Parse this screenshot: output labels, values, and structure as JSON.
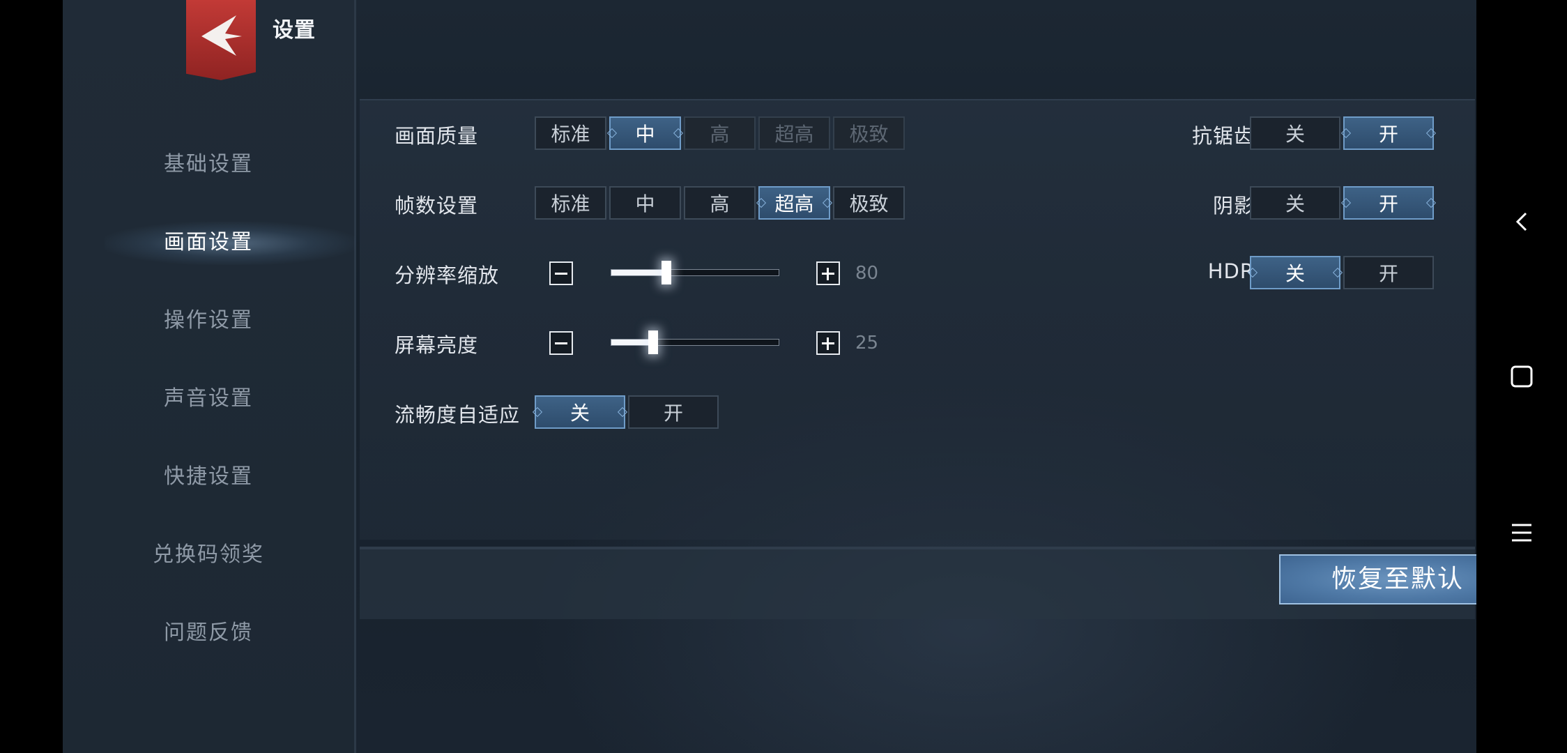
{
  "header": {
    "title": "设置"
  },
  "sidebar": {
    "items": [
      {
        "label": "基础设置",
        "active": false
      },
      {
        "label": "画面设置",
        "active": true
      },
      {
        "label": "操作设置",
        "active": false
      },
      {
        "label": "声音设置",
        "active": false
      },
      {
        "label": "快捷设置",
        "active": false
      },
      {
        "label": "兑换码领奖",
        "active": false
      },
      {
        "label": "问题反馈",
        "active": false
      }
    ]
  },
  "settings": {
    "graphics_quality": {
      "label": "画面质量",
      "options": [
        "标准",
        "中",
        "高",
        "超高",
        "极致"
      ],
      "selected": "中"
    },
    "frame_rate": {
      "label": "帧数设置",
      "options": [
        "标准",
        "中",
        "高",
        "超高",
        "极致"
      ],
      "selected": "超高"
    },
    "resolution_scale": {
      "label": "分辨率缩放",
      "value": "80",
      "fill_percent": 33
    },
    "screen_brightness": {
      "label": "屏幕亮度",
      "value": "25",
      "fill_percent": 25
    },
    "adaptive_smoothness": {
      "label": "流畅度自适应",
      "off": "关",
      "on": "开",
      "selected": "关"
    },
    "anti_aliasing": {
      "label": "抗锯齿",
      "off": "关",
      "on": "开",
      "selected": "开"
    },
    "shadow": {
      "label": "阴影",
      "off": "关",
      "on": "开",
      "selected": "开"
    },
    "hdr": {
      "label": "HDR",
      "off": "关",
      "on": "开",
      "selected": "关"
    }
  },
  "footer": {
    "reset_label": "恢复至默认"
  },
  "colors": {
    "accent": "#4f79a6",
    "logo": "#b8322f",
    "background": "#1a2430"
  },
  "system_nav": {
    "icons": [
      "back-icon",
      "home-icon",
      "menu-icon"
    ]
  }
}
